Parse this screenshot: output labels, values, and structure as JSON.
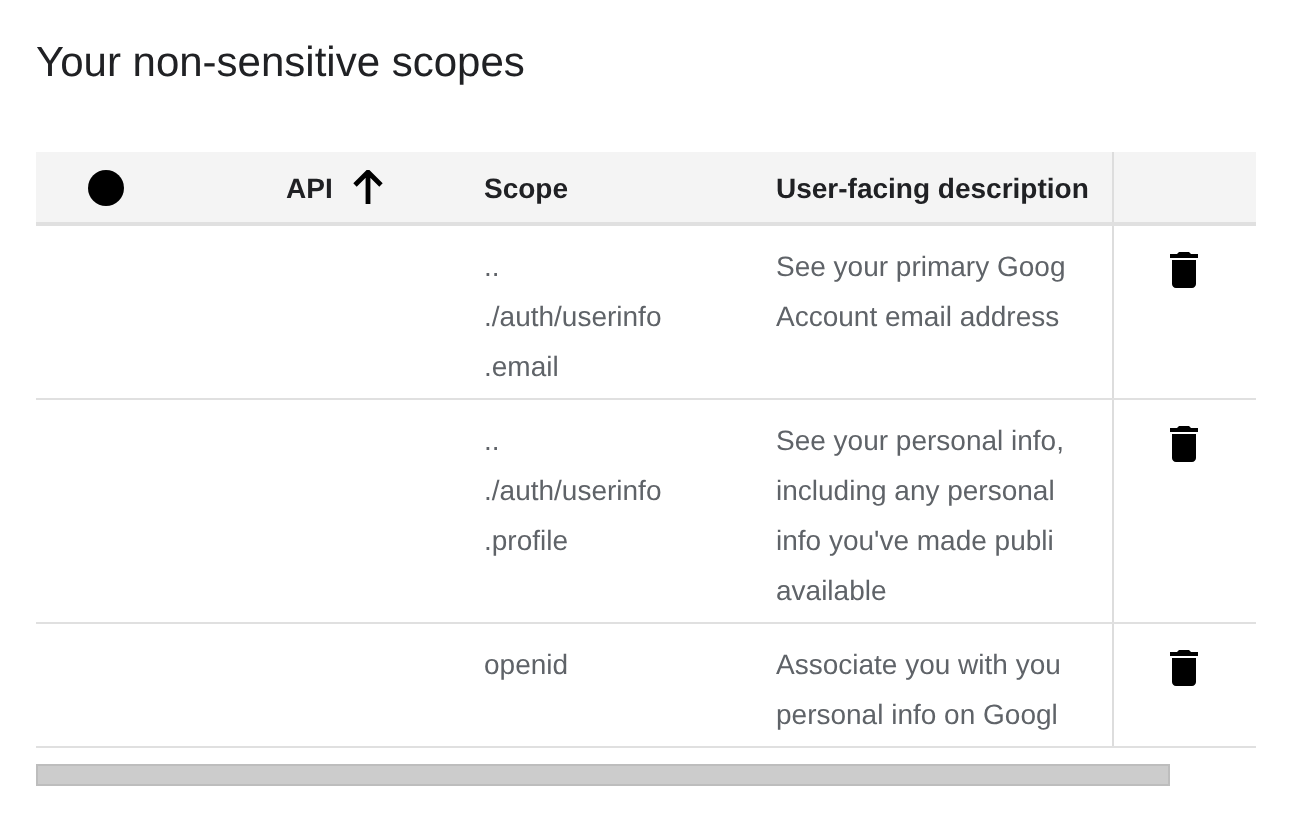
{
  "title": "Your non-sensitive scopes",
  "table": {
    "columns": [
      {
        "label": "API",
        "sort_ascending": true
      },
      {
        "label": "Scope"
      },
      {
        "label": "User-facing description"
      }
    ],
    "rows": [
      {
        "scope": [
          "..",
          "./auth/userinfo",
          ".email"
        ],
        "description": [
          "See your primary Goog",
          "Account email address"
        ]
      },
      {
        "scope": [
          "..",
          "./auth/userinfo",
          ".profile"
        ],
        "description": [
          "See your personal info,",
          "including any personal",
          "info you've made publi",
          "available"
        ]
      },
      {
        "scope": [
          "openid"
        ],
        "description": [
          "Associate you with you",
          "personal info on Googl"
        ]
      }
    ]
  }
}
